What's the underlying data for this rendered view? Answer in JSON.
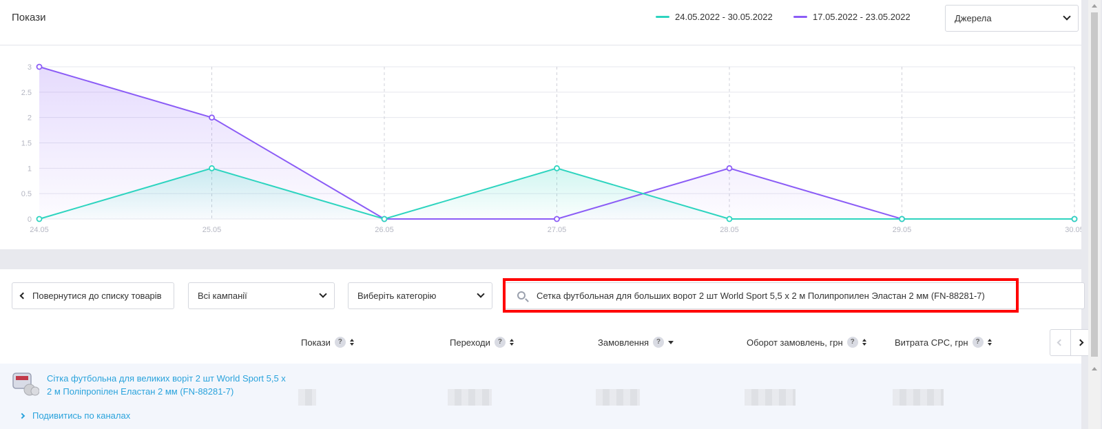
{
  "header": {
    "title": "Покази",
    "legend": [
      {
        "label": "24.05.2022 - 30.05.2022",
        "color": "#2dd4bf"
      },
      {
        "label": "17.05.2022 - 23.05.2022",
        "color": "#8b5cf6"
      }
    ],
    "sources_select": "Джерела"
  },
  "chart_data": {
    "type": "line",
    "categories": [
      "24.05",
      "25.05",
      "26.05",
      "27.05",
      "28.05",
      "29.05",
      "30.05"
    ],
    "y_ticks": [
      "0",
      "0.5",
      "1",
      "1.5",
      "2",
      "2.5",
      "3"
    ],
    "ylim": [
      0,
      3
    ],
    "grid": true,
    "legend_position": "top-right",
    "series": [
      {
        "name": "24.05.2022 - 30.05.2022",
        "color": "#2dd4bf",
        "values": [
          0,
          1,
          0,
          1,
          0,
          0,
          0
        ]
      },
      {
        "name": "17.05.2022 - 23.05.2022",
        "color": "#8b5cf6",
        "values": [
          3,
          2,
          0,
          0,
          1,
          0,
          0
        ]
      }
    ]
  },
  "filters": {
    "back_label": "Повернутися до списку товарів",
    "campaign_select": "Всі кампанії",
    "category_select": "Виберіть категорію",
    "search_value": "Сетка футбольная для больших ворот 2 шт World Sport 5,5 х 2 м Полипропилен Эластан 2 мм (FN-88281-7)"
  },
  "table": {
    "columns": [
      {
        "label": "Покази",
        "help": "?"
      },
      {
        "label": "Переходи",
        "help": "?"
      },
      {
        "label": "Замовлення",
        "help": "?"
      },
      {
        "label": "Оборот замовлень, грн",
        "help": "?"
      },
      {
        "label": "Витрата CPC, грн",
        "help": "?"
      }
    ],
    "rows": [
      {
        "product_name": "Сітка футбольна для великих воріт 2 шт World Sport 5,5 х 2 м Поліпропілен Еластан 2 мм (FN-88281-7)",
        "channels_link": "Подивитись по каналах"
      }
    ]
  }
}
